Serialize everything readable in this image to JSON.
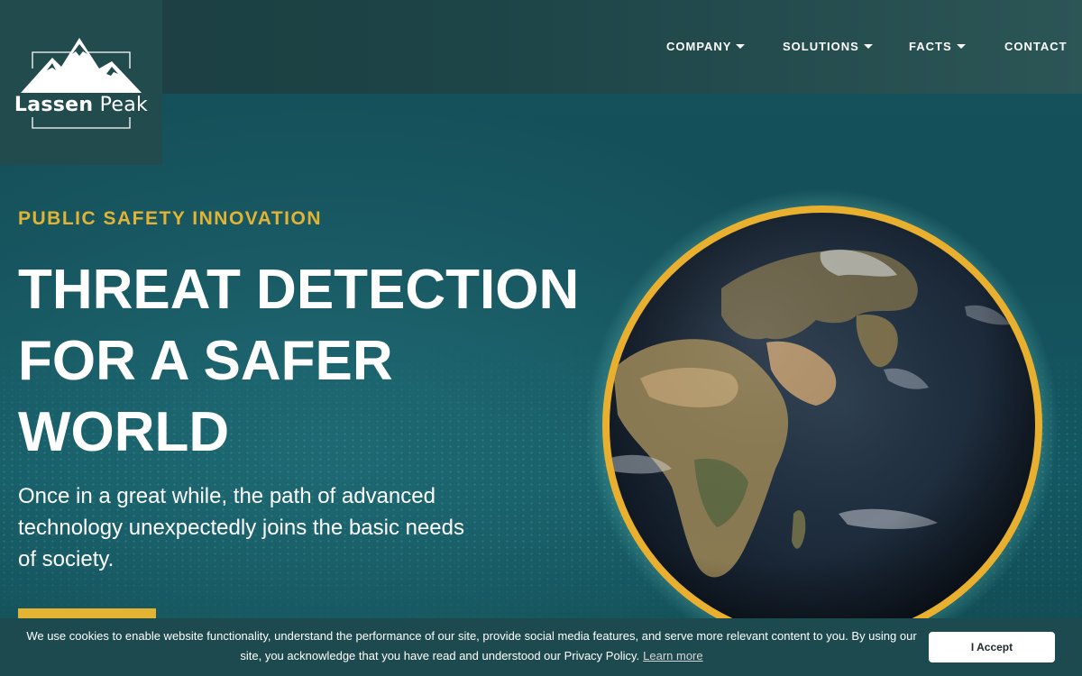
{
  "brand": {
    "name_bold": "Lassen",
    "name_light": "Peak"
  },
  "nav": {
    "items": [
      {
        "label": "COMPANY",
        "has_dropdown": true
      },
      {
        "label": "SOLUTIONS",
        "has_dropdown": true
      },
      {
        "label": "FACTS",
        "has_dropdown": true
      },
      {
        "label": "CONTACT",
        "has_dropdown": false
      }
    ]
  },
  "hero": {
    "eyebrow": "PUBLIC SAFETY INNOVATION",
    "headline_lines": [
      "THREAT DETECTION",
      "FOR A SAFER",
      "WORLD"
    ],
    "subtext": "Once in a great while, the path of advanced technology unexpectedly joins the basic needs of society."
  },
  "cookie_banner": {
    "message": "We use cookies to enable website functionality, understand the performance of our site, provide social media features, and serve more relevant content to you. By using our site, you acknowledge that you have read and understood our Privacy Policy.",
    "learn_more": "Learn more",
    "accept_label": "I Accept"
  },
  "colors": {
    "accent": "#e3b434",
    "background": "#134b52",
    "topbar": "#1d4446",
    "logo_box": "#214b4d",
    "cookie_bar": "#1d4a4f"
  },
  "icons": {
    "logo": "mountain-logo-icon",
    "dropdown": "chevron-down-icon",
    "hero_image": "earth-globe-icon"
  }
}
